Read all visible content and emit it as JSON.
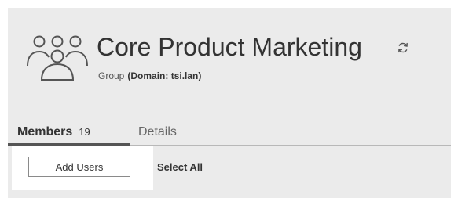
{
  "header": {
    "title": "Core Product Marketing",
    "type_label": "Group",
    "domain_label": "(Domain: tsi.lan)",
    "icon": "group-icon",
    "refresh_icon": "refresh-icon"
  },
  "tabs": [
    {
      "label": "Members",
      "count": "19",
      "active": true
    },
    {
      "label": "Details",
      "active": false
    }
  ],
  "toolbar": {
    "add_users_label": "Add Users",
    "select_all_label": "Select All"
  },
  "colors": {
    "panel_background": "#ebebeb",
    "highlight_background": "#ffffff",
    "text": "#333333",
    "inactive_tab_text": "#666666",
    "active_tab_indicator": "#555555"
  }
}
